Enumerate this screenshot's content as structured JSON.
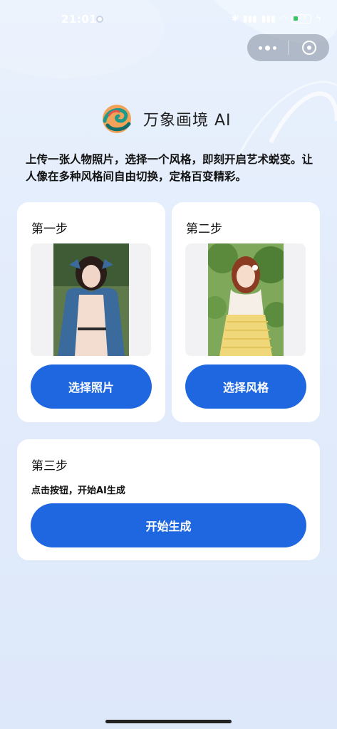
{
  "status_bar": {
    "time": "21:01",
    "battery": "18"
  },
  "capsule": {
    "more_icon": "more-dots-icon",
    "close_icon": "target-close-icon"
  },
  "header": {
    "title": "万象画境 AI",
    "logo_icon": "swirl-logo-icon"
  },
  "intro": "上传一张人物照片，选择一个风格，即刻开启艺术蜕变。让人像在多种风格间自由切换，定格百变精彩。",
  "steps": [
    {
      "title": "第一步",
      "button_label": "选择照片"
    },
    {
      "title": "第二步",
      "button_label": "选择风格"
    },
    {
      "title": "第三步",
      "description": "点击按钮，开始AI生成",
      "button_label": "开始生成"
    }
  ],
  "colors": {
    "accent": "#1f67e0",
    "background": "#e6eefc",
    "card": "#ffffff"
  }
}
